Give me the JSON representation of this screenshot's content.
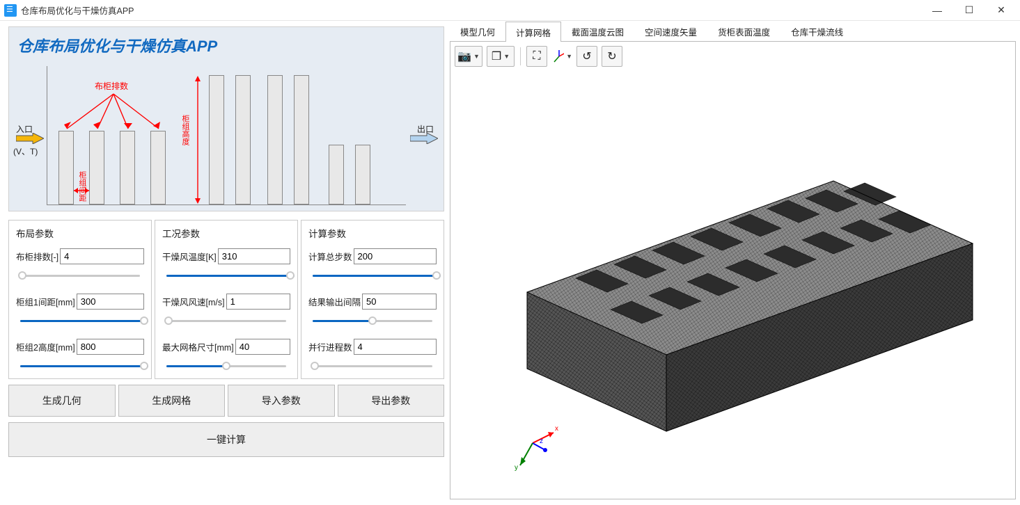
{
  "window": {
    "title": "仓库布局优化与干燥仿真APP"
  },
  "hero": {
    "title": "仓库布局优化与干燥仿真APP",
    "labels": {
      "inlet": "入口",
      "vt": "(V、T)",
      "outlet": "出口",
      "rack_count": "布柜排数",
      "rack_spacing": "柜组间距",
      "rack_height": "柜组高度"
    }
  },
  "params": {
    "layout": {
      "title": "布局参数",
      "items": [
        {
          "label": "布柜排数[-]",
          "value": "4",
          "slider": 5
        },
        {
          "label": "柜组1间距[mm]",
          "value": "300",
          "slider": 100
        },
        {
          "label": "柜组2高度[mm]",
          "value": "800",
          "slider": 100
        }
      ]
    },
    "condition": {
      "title": "工况参数",
      "items": [
        {
          "label": "干燥风温度[K]",
          "value": "310",
          "slider": 100
        },
        {
          "label": "干燥风风速[m/s]",
          "value": "1",
          "slider": 5
        },
        {
          "label": "最大网格尺寸[mm]",
          "value": "40",
          "slider": 50
        }
      ]
    },
    "compute": {
      "title": "计算参数",
      "items": [
        {
          "label": "计算总步数",
          "value": "200",
          "slider": 100
        },
        {
          "label": "结果输出间隔",
          "value": "50",
          "slider": 50
        },
        {
          "label": "并行进程数",
          "value": "4",
          "slider": 5
        }
      ]
    }
  },
  "buttons": {
    "gen_geometry": "生成几何",
    "gen_mesh": "生成网格",
    "import": "导入参数",
    "export": "导出参数",
    "calculate": "一键计算"
  },
  "tabs": [
    {
      "label": "模型几何",
      "active": false
    },
    {
      "label": "计算网格",
      "active": true
    },
    {
      "label": "截面温度云图",
      "active": false
    },
    {
      "label": "空间速度矢量",
      "active": false
    },
    {
      "label": "货柜表面温度",
      "active": false
    },
    {
      "label": "仓库干燥流线",
      "active": false
    }
  ],
  "axis": {
    "x": "x",
    "y": "y",
    "z": "z"
  }
}
